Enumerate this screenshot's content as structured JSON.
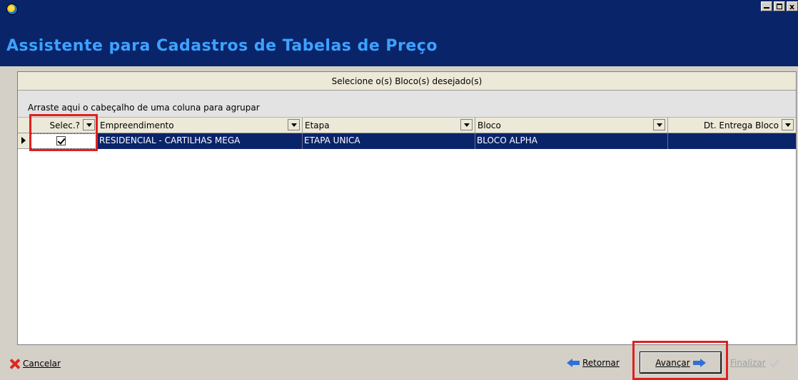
{
  "window": {
    "title": "",
    "controls": {
      "minimize": "_",
      "maximize": "□",
      "close": "x"
    }
  },
  "header": {
    "title": "Assistente para Cadastros de Tabelas de Preço",
    "title_color": "#3ca3ff",
    "background": "#0a246a"
  },
  "grid": {
    "caption": "Selecione o(s) Bloco(s) desejado(s)",
    "group_hint": "Arraste aqui o cabeçalho de uma coluna para agrupar",
    "columns": [
      "Selec.?",
      "Empreendimento",
      "Etapa",
      "Bloco",
      "Dt. Entrega Bloco"
    ],
    "rows": [
      {
        "selected": true,
        "empreendimento": "RESIDENCIAL - CARTILHAS MEGA",
        "etapa": "ETAPA UNICA",
        "bloco": "BLOCO ALPHA",
        "dt_entrega": ""
      }
    ],
    "selection_color": "#0a246a"
  },
  "footer": {
    "cancel": {
      "label": "Cancelar",
      "icon": "cancel-x-icon"
    },
    "back": {
      "label": "Retornar",
      "icon": "arrow-left-icon"
    },
    "next": {
      "label": "Avançar",
      "icon": "arrow-right-icon"
    },
    "finish": {
      "label": "Finalizar",
      "icon": "check-icon",
      "enabled": false
    }
  },
  "highlight_color": "#e02020"
}
